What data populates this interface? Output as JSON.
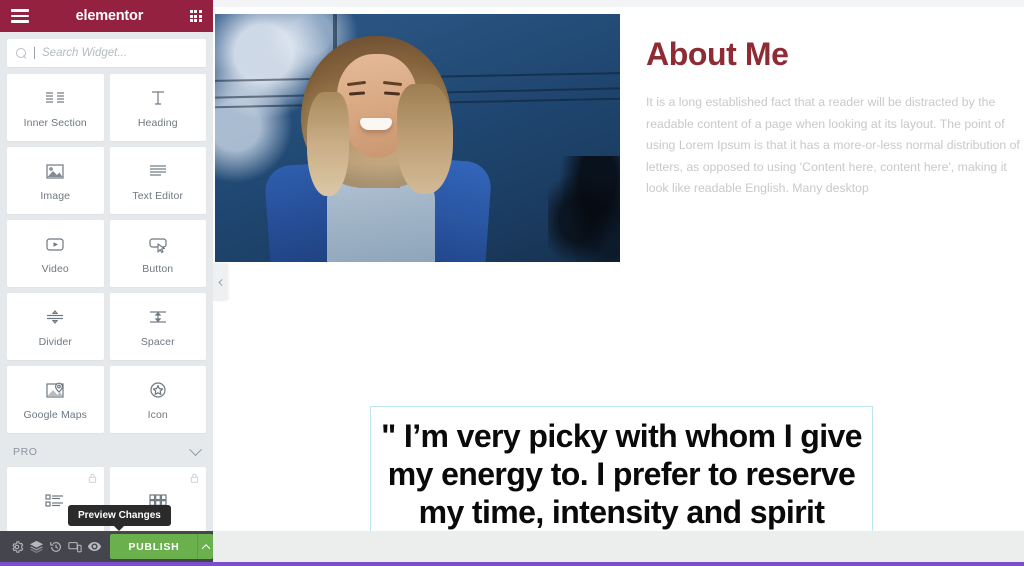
{
  "app": {
    "name": "elementor",
    "menu_icon": "hamburger-icon",
    "apps_icon": "grid-apps-icon"
  },
  "search": {
    "placeholder": "Search Widget...",
    "value": "",
    "icon": "search-icon"
  },
  "widgets": {
    "basic": [
      {
        "label": "Inner Section",
        "icon": "inner-section-icon",
        "locked": false
      },
      {
        "label": "Heading",
        "icon": "heading-icon",
        "locked": false
      },
      {
        "label": "Image",
        "icon": "image-icon",
        "locked": false
      },
      {
        "label": "Text Editor",
        "icon": "text-editor-icon",
        "locked": false
      },
      {
        "label": "Video",
        "icon": "video-icon",
        "locked": false
      },
      {
        "label": "Button",
        "icon": "button-icon",
        "locked": false
      },
      {
        "label": "Divider",
        "icon": "divider-icon",
        "locked": false
      },
      {
        "label": "Spacer",
        "icon": "spacer-icon",
        "locked": false
      },
      {
        "label": "Google Maps",
        "icon": "google-maps-icon",
        "locked": false
      },
      {
        "label": "Icon",
        "icon": "star-icon",
        "locked": false
      }
    ],
    "pro_section": {
      "title": "PRO",
      "collapse_icon": "chevron-down-icon",
      "items": [
        {
          "label": "",
          "icon": "icon-list-icon",
          "locked": true,
          "lock_icon": "lock-icon"
        },
        {
          "label": "",
          "icon": "gallery-icon",
          "locked": true,
          "lock_icon": "lock-icon"
        }
      ]
    }
  },
  "bottom_bar": {
    "icons": [
      {
        "name": "settings-gear-icon",
        "title": "Settings"
      },
      {
        "name": "navigator-layers-icon",
        "title": "Navigator"
      },
      {
        "name": "history-icon",
        "title": "History"
      },
      {
        "name": "responsive-mode-icon",
        "title": "Responsive Mode"
      },
      {
        "name": "preview-eye-icon",
        "title": "Preview Changes"
      }
    ],
    "publish_label": "PUBLISH",
    "publish_arrow_icon": "chevron-up-icon",
    "tooltip": "Preview Changes"
  },
  "panel_collapse": {
    "icon": "chevron-left-icon"
  },
  "canvas": {
    "hero_image": {
      "alt": "smiling woman with blonde hair wearing a denim jacket in front of a blue wall"
    },
    "about": {
      "title": "About Me",
      "body": "It is a long established fact that a reader will be distracted by the readable content of a page when looking at its layout. The point of using Lorem Ipsum is that it has a more-or-less normal distribution of letters, as opposed to using 'Content here, content here', making it look like readable English. Many desktop"
    },
    "quote": {
      "text": "\" I’m very picky with whom I give my energy to. I prefer to reserve my time, intensity and spirit exclusively to those who"
    }
  },
  "colors": {
    "brand_maroon": "#93213f",
    "heading_red": "#8e2b34",
    "publish_green": "#6ab04c",
    "panel_bg": "#e6e9ec",
    "bottom_bar_bg": "#44454d",
    "selection_border": "#bde5f2",
    "progress_purple": "#7c4dcc"
  }
}
